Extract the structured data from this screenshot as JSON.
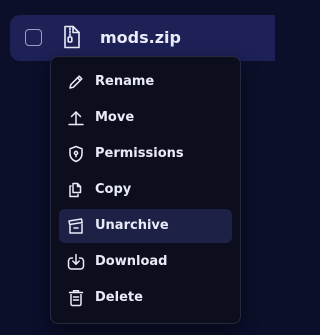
{
  "file": {
    "name": "mods.zip",
    "icon": "zip-file-icon",
    "checked": false
  },
  "menu": {
    "items": [
      {
        "label": "Rename",
        "icon": "pencil-icon"
      },
      {
        "label": "Move",
        "icon": "move-arrow-icon"
      },
      {
        "label": "Permissions",
        "icon": "shield-icon"
      },
      {
        "label": "Copy",
        "icon": "copy-icon"
      },
      {
        "label": "Unarchive",
        "icon": "unarchive-icon",
        "highlighted": true
      },
      {
        "label": "Download",
        "icon": "download-icon"
      },
      {
        "label": "Delete",
        "icon": "trash-icon"
      }
    ]
  },
  "colors": {
    "background": "#0b0f2a",
    "row_highlight": "#1d2156",
    "menu_background": "#0c0e1e",
    "item_highlight": "#1d2146",
    "text": "#e9ebf8"
  }
}
